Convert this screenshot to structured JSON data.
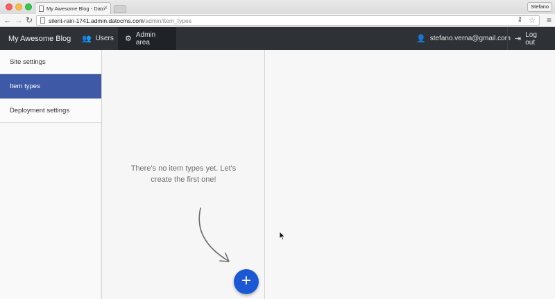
{
  "browser": {
    "tab_title": "My Awesome Blog - Dato",
    "tab_close": "×",
    "profile": "Stefano",
    "nav_back": "←",
    "nav_forward": "→",
    "nav_reload": "↻",
    "url_host": "silent-rain-1741.admin.datocms.com",
    "url_path": "/admin/item_types",
    "url_key_icon": "⚷",
    "url_star_icon": "☆",
    "menu_icon": "≡"
  },
  "header": {
    "brand": "My Awesome Blog",
    "nav": [
      {
        "label": "Users",
        "icon": "users-icon",
        "glyph": "👥"
      },
      {
        "label": "Admin area",
        "icon": "gear-icon",
        "glyph": "⚙"
      }
    ],
    "user_email": "stefano.verna@gmail.com",
    "user_glyph": "👤",
    "logout_label": "Log out",
    "logout_glyph": "⇥"
  },
  "sidebar": {
    "items": [
      {
        "label": "Site settings",
        "active": false
      },
      {
        "label": "Item types",
        "active": true
      },
      {
        "label": "Deployment settings",
        "active": false
      }
    ]
  },
  "main": {
    "empty_line1": "There's no item types yet. Let's",
    "empty_line2": "create the first one!",
    "add_button_glyph": "+"
  },
  "colors": {
    "header_bg": "#2e3136",
    "sidebar_active": "#3e5aa6",
    "fab": "#1c58d4"
  }
}
